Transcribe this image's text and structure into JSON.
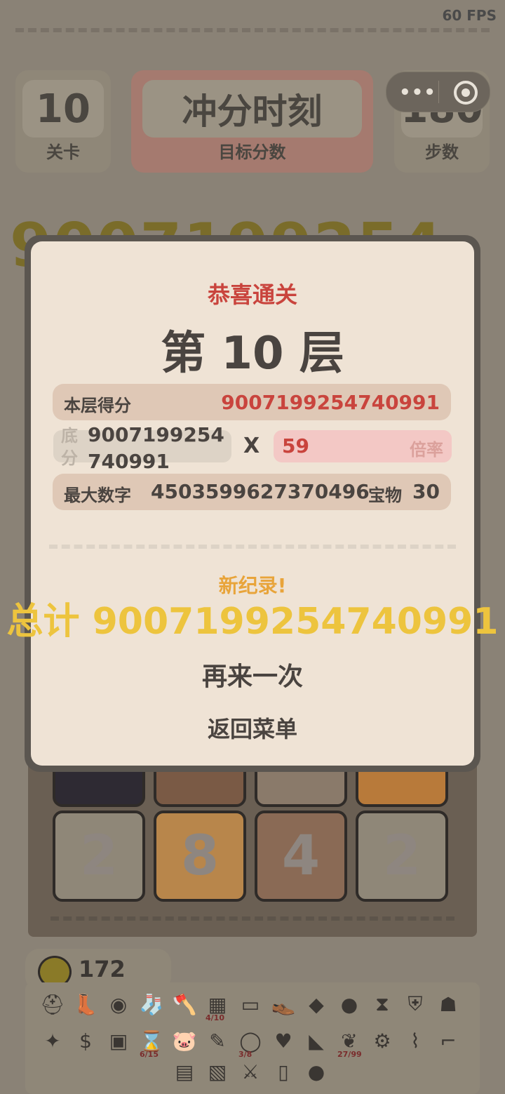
{
  "status": {
    "fps": "60 FPS"
  },
  "hud": {
    "level_value": "10",
    "level_label": "关卡",
    "target_value": "冲分时刻",
    "target_label": "目标分数",
    "steps_value": "180",
    "steps_label": "步数"
  },
  "background": {
    "big_score_partial": "9007199254"
  },
  "board": {
    "tiles": [
      {
        "value": "",
        "color": "#2e2a33"
      },
      {
        "value": "",
        "color": "#7a5a45"
      },
      {
        "value": "",
        "color": "#8a7a6a"
      },
      {
        "value": "",
        "color": "#b87a3a"
      },
      {
        "value": "2",
        "color": "#8f8778"
      },
      {
        "value": "8",
        "color": "#b8864b"
      },
      {
        "value": "4",
        "color": "#8a6a55"
      },
      {
        "value": "2",
        "color": "#8f8778"
      }
    ]
  },
  "coins": {
    "value": "172"
  },
  "items": [
    {
      "icon": "helmet-icon",
      "glyph": "⛑"
    },
    {
      "icon": "boot-icon",
      "glyph": "👢"
    },
    {
      "icon": "black-ring-icon",
      "glyph": "◉"
    },
    {
      "icon": "sock-icon",
      "glyph": "🧦"
    },
    {
      "icon": "axe-icon",
      "glyph": "🪓"
    },
    {
      "icon": "machine-icon",
      "glyph": "▦",
      "count": "4/10"
    },
    {
      "icon": "minus-90-tag-icon",
      "glyph": "▭"
    },
    {
      "icon": "brown-boot-icon",
      "glyph": "👞"
    },
    {
      "icon": "crystal-icon",
      "glyph": "◆"
    },
    {
      "icon": "gold-orb-icon",
      "glyph": "●"
    },
    {
      "icon": "hourglass-statue-icon",
      "glyph": "⧗"
    },
    {
      "icon": "shield-icon",
      "glyph": "⛨"
    },
    {
      "icon": "hood-icon",
      "glyph": "☗"
    },
    {
      "icon": "purple-gem-icon",
      "glyph": "✦"
    },
    {
      "icon": "gold-coin-icon",
      "glyph": "$"
    },
    {
      "icon": "purple-chest-icon",
      "glyph": "▣"
    },
    {
      "icon": "hourglass-icon",
      "glyph": "⌛",
      "count": "6/15"
    },
    {
      "icon": "piggy-bank-icon",
      "glyph": "🐷"
    },
    {
      "icon": "pen-icon",
      "glyph": "✎"
    },
    {
      "icon": "gold-ring-icon",
      "glyph": "◯",
      "count": "3/8"
    },
    {
      "icon": "heart-icon",
      "glyph": "♥"
    },
    {
      "icon": "drill-icon",
      "glyph": "◣"
    },
    {
      "icon": "leaf-icon",
      "glyph": "❦",
      "count": "27/99"
    },
    {
      "icon": "gear-icon",
      "glyph": "⚙"
    },
    {
      "icon": "pipe-icon",
      "glyph": "⌇"
    },
    {
      "icon": "gun-icon",
      "glyph": "⌐"
    },
    {
      "icon": "card-icon",
      "glyph": "▤"
    },
    {
      "icon": "blue-chest-icon",
      "glyph": "▧"
    },
    {
      "icon": "swords-icon",
      "glyph": "⚔"
    },
    {
      "icon": "glass-icon",
      "glyph": "▯"
    },
    {
      "icon": "blue-orb-icon",
      "glyph": "●"
    }
  ],
  "modal": {
    "congrats": "恭喜通关",
    "floor_title": "第 10 层",
    "score_label": "本层得分",
    "score_value": "9007199254740991",
    "base_label": "底分",
    "base_value_line1": "9007199254",
    "base_value_line2": "740991",
    "times": "X",
    "multiplier_value": "59",
    "multiplier_label": "倍率",
    "max_label": "最大数字",
    "max_value": "4503599627370496",
    "treasure_label": "宝物",
    "treasure_value": "30",
    "new_record": "新纪录!",
    "total_label": "总计",
    "total_value": "9007199254740991",
    "retry": "再来一次",
    "back": "返回菜单"
  }
}
